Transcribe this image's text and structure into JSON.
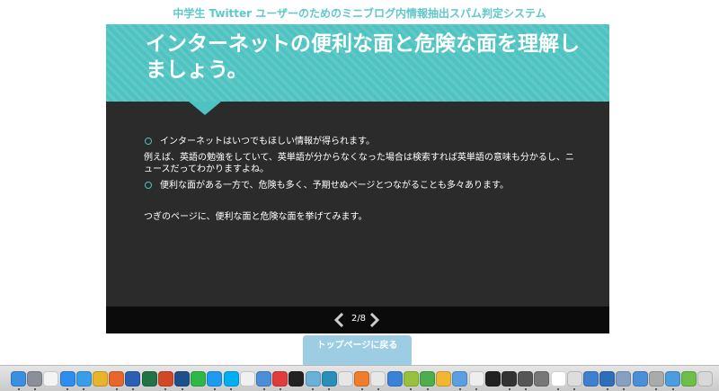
{
  "app": {
    "title": "中学生 Twitter ユーザーのためのミニブログ内情報抽出スパム判定システム"
  },
  "slide": {
    "heading": "インターネットの便利な面と危険な面を理解しましょう。",
    "bullets": [
      "インターネットはいつでもほしい情報が得られます。",
      "例えば、英語の勉強をしていて、英単語が分からなくなった場合は検索すれば英単語の意味も分かるし、ニュースだってわかりますよね。",
      "便利な面がある一方で、危険も多く、予期せぬページとつながることも多々あります。",
      "つぎのページに、便利な面と危険な面を挙げてみます。"
    ],
    "page_indicator": "2/8"
  },
  "footer": {
    "top_button_label": "トップページに戻る"
  },
  "colors": {
    "accent": "#4ec3c1",
    "title_text": "#5ec8cc",
    "slide_bg": "#2b2b2b",
    "footer_bg": "#0b0b0b",
    "button_bg": "#9ccde3"
  },
  "dock": {
    "icons": [
      {
        "name": "finder-icon",
        "color": "#3b8fe0"
      },
      {
        "name": "launchpad-icon",
        "color": "#8a8f99"
      },
      {
        "name": "calendar-icon",
        "color": "#f4f4f4"
      },
      {
        "name": "app-store-icon",
        "color": "#2f8df0"
      },
      {
        "name": "safari-icon",
        "color": "#3a9de8"
      },
      {
        "name": "chrome-icon",
        "color": "#e8b42c"
      },
      {
        "name": "firefox-icon",
        "color": "#e8652c"
      },
      {
        "name": "word-icon",
        "color": "#2b5fb4"
      },
      {
        "name": "excel-icon",
        "color": "#217346"
      },
      {
        "name": "powerpoint-icon",
        "color": "#d24726"
      },
      {
        "name": "photoshop-icon",
        "color": "#1f4e8c"
      },
      {
        "name": "line-icon",
        "color": "#2fb84a"
      },
      {
        "name": "twitter-icon",
        "color": "#1d9bf0"
      },
      {
        "name": "skype-icon",
        "color": "#00aff0"
      },
      {
        "name": "app-icon",
        "color": "#f0f0f0"
      },
      {
        "name": "messages-icon",
        "color": "#4a8fd8"
      },
      {
        "name": "video-icon",
        "color": "#e03c3c"
      },
      {
        "name": "unity-icon",
        "color": "#222222"
      },
      {
        "name": "app-icon",
        "color": "#6ab0d8"
      },
      {
        "name": "app-icon",
        "color": "#2a8fb8"
      },
      {
        "name": "app-icon",
        "color": "#e6e6e6"
      },
      {
        "name": "sublime-icon",
        "color": "#f07d2c"
      },
      {
        "name": "app-icon",
        "color": "#e8e8e8"
      },
      {
        "name": "xcode-icon",
        "color": "#3a82d8"
      },
      {
        "name": "android-icon",
        "color": "#98c23c"
      },
      {
        "name": "app-icon",
        "color": "#4cae4c"
      },
      {
        "name": "app-icon",
        "color": "#f2b632"
      },
      {
        "name": "app-icon",
        "color": "#5aa0e0"
      },
      {
        "name": "app-icon",
        "color": "#eeeeee"
      },
      {
        "name": "terminal-icon",
        "color": "#222222"
      },
      {
        "name": "activity-icon",
        "color": "#333333"
      },
      {
        "name": "app-icon",
        "color": "#555555"
      },
      {
        "name": "app-icon",
        "color": "#777777"
      },
      {
        "name": "app-icon",
        "color": "#ffffff"
      },
      {
        "name": "app-icon",
        "color": "#dddddd"
      },
      {
        "name": "app-icon",
        "color": "#3f7fcf"
      },
      {
        "name": "app-icon",
        "color": "#2c6fb8"
      },
      {
        "name": "app-icon",
        "color": "#88a0c0"
      },
      {
        "name": "app-icon",
        "color": "#4a90d8"
      },
      {
        "name": "app-icon",
        "color": "#aaaaaa"
      },
      {
        "name": "app-icon",
        "color": "#4b9de0"
      },
      {
        "name": "app-icon",
        "color": "#6dbf4a"
      },
      {
        "name": "trash-icon",
        "color": "#d8d8d8"
      }
    ]
  }
}
